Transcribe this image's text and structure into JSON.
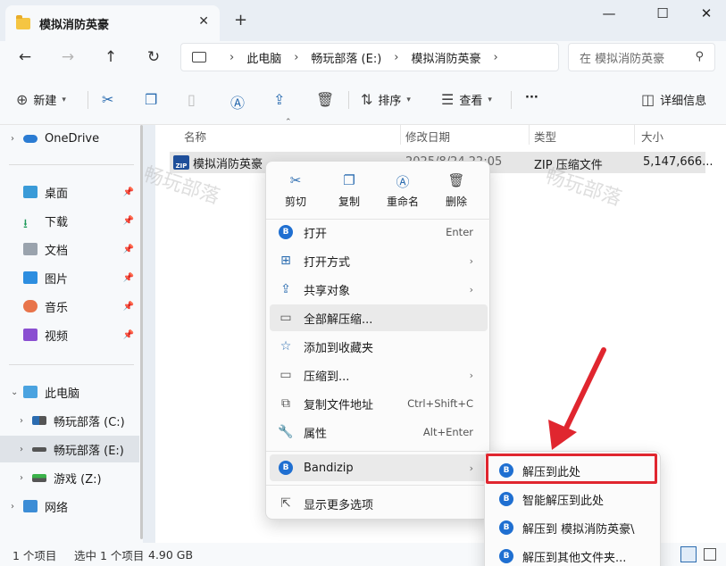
{
  "window": {
    "tab_title": "模拟消防英豪",
    "new_tab": "+",
    "tab_close": "✕",
    "minimize": "—",
    "maximize": "☐",
    "close": "✕"
  },
  "address": {
    "crumbs": [
      "此电脑",
      "畅玩部落 (E:)",
      "模拟消防英豪"
    ],
    "search_placeholder": "在 模拟消防英豪"
  },
  "toolbar": {
    "new_label": "新建",
    "sort_label": "排序",
    "view_label": "查看",
    "more_label": "···",
    "details_label": "详细信息"
  },
  "sidebar": {
    "items": [
      {
        "label": "OneDrive"
      },
      {
        "label": "桌面"
      },
      {
        "label": "下载"
      },
      {
        "label": "文档"
      },
      {
        "label": "图片"
      },
      {
        "label": "音乐"
      },
      {
        "label": "视频"
      },
      {
        "label": "此电脑"
      },
      {
        "label": "畅玩部落 (C:)"
      },
      {
        "label": "畅玩部落 (E:)"
      },
      {
        "label": "游戏 (Z:)"
      },
      {
        "label": "网络"
      }
    ]
  },
  "filelist": {
    "columns": [
      "名称",
      "修改日期",
      "类型",
      "大小"
    ],
    "rows": [
      {
        "name": "模拟消防英豪",
        "date": "2025/8/24 22:05",
        "type": "ZIP 压缩文件",
        "size": "5,147,666..."
      }
    ],
    "zip_badge": "ZIP"
  },
  "watermark": "畅玩部落",
  "status": {
    "item_count": "1 个项目",
    "selected": "选中 1 个项目",
    "size": "4.90 GB"
  },
  "context_menu": {
    "quick_actions": [
      "剪切",
      "复制",
      "重命名",
      "删除"
    ],
    "items": [
      {
        "label": "打开",
        "shortcut": "Enter"
      },
      {
        "label": "打开方式",
        "shortcut": ""
      },
      {
        "label": "共享对象",
        "shortcut": ""
      },
      {
        "label": "全部解压缩...",
        "shortcut": ""
      },
      {
        "label": "添加到收藏夹",
        "shortcut": ""
      },
      {
        "label": "压缩到...",
        "shortcut": ""
      },
      {
        "label": "复制文件地址",
        "shortcut": "Ctrl+Shift+C"
      },
      {
        "label": "属性",
        "shortcut": "Alt+Enter"
      },
      {
        "label": "Bandizip",
        "shortcut": ""
      },
      {
        "label": "显示更多选项",
        "shortcut": ""
      }
    ]
  },
  "bandizip_submenu": {
    "items": [
      "解压到此处",
      "智能解压到此处",
      "解压到 模拟消防英豪\\",
      "解压到其他文件夹..."
    ]
  },
  "colors": {
    "accent": "#2b6cb0",
    "annotation_red": "#e0262f"
  }
}
